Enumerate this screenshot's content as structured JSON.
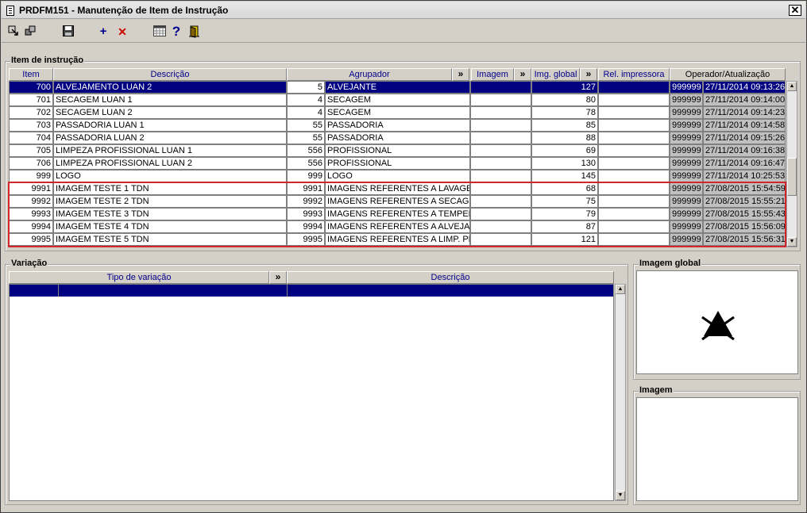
{
  "window": {
    "title": "PRDFM151 - Manutenção de Item de Instrução",
    "close_label": "✕"
  },
  "toolbar": {
    "icons": [
      "back-icon",
      "copy-icon",
      "save-icon",
      "add-icon",
      "delete-icon",
      "calendar-grid-icon",
      "help-icon",
      "exit-door-icon"
    ],
    "add_label": "+",
    "delete_label": "✕",
    "help_label": "?"
  },
  "item_section": {
    "legend": "Item de instrução",
    "columns": {
      "item": "Item",
      "descricao": "Descrição",
      "agrupador": "Agrupador",
      "imagem": "Imagem",
      "img_global": "Img. global",
      "rel_impressora": "Rel. impressora",
      "operador": "Operador/Atualização",
      "more": "»"
    },
    "rows": [
      {
        "item": "700",
        "descricao": "ALVEJAMENTO LUAN 2",
        "agr_code": "5",
        "agr_desc": "ALVEJANTE",
        "imagem": "",
        "img_global": "127",
        "rel": "",
        "operador": "999999",
        "data": "27/11/2014 09:13:26"
      },
      {
        "item": "701",
        "descricao": "SECAGEM LUAN 1",
        "agr_code": "4",
        "agr_desc": "SECAGEM",
        "imagem": "",
        "img_global": "80",
        "rel": "",
        "operador": "999999",
        "data": "27/11/2014 09:14:00"
      },
      {
        "item": "702",
        "descricao": "SECAGEM LUAN 2",
        "agr_code": "4",
        "agr_desc": "SECAGEM",
        "imagem": "",
        "img_global": "78",
        "rel": "",
        "operador": "999999",
        "data": "27/11/2014 09:14:23"
      },
      {
        "item": "703",
        "descricao": "PASSADORIA LUAN 1",
        "agr_code": "55",
        "agr_desc": "PASSADORIA",
        "imagem": "",
        "img_global": "85",
        "rel": "",
        "operador": "999999",
        "data": "27/11/2014 09:14:58"
      },
      {
        "item": "704",
        "descricao": "PASSADORIA LUAN 2",
        "agr_code": "55",
        "agr_desc": "PASSADORIA",
        "imagem": "",
        "img_global": "88",
        "rel": "",
        "operador": "999999",
        "data": "27/11/2014 09:15:26"
      },
      {
        "item": "705",
        "descricao": "LIMPEZA PROFISSIONAL LUAN 1",
        "agr_code": "556",
        "agr_desc": "PROFISSIONAL",
        "imagem": "",
        "img_global": "69",
        "rel": "",
        "operador": "999999",
        "data": "27/11/2014 09:16:38"
      },
      {
        "item": "706",
        "descricao": "LIMPEZA PROFISSIONAL LUAN 2",
        "agr_code": "556",
        "agr_desc": "PROFISSIONAL",
        "imagem": "",
        "img_global": "130",
        "rel": "",
        "operador": "999999",
        "data": "27/11/2014 09:16:47"
      },
      {
        "item": "999",
        "descricao": "LOGO",
        "agr_code": "999",
        "agr_desc": "LOGO",
        "imagem": "",
        "img_global": "145",
        "rel": "",
        "operador": "999999",
        "data": "27/11/2014 10:25:53"
      },
      {
        "item": "9991",
        "descricao": "IMAGEM TESTE 1 TDN",
        "agr_code": "9991",
        "agr_desc": "IMAGENS REFERENTES A LAVAGEM",
        "imagem": "",
        "img_global": "68",
        "rel": "",
        "operador": "999999",
        "data": "27/08/2015 15:54:59"
      },
      {
        "item": "9992",
        "descricao": "IMAGEM TESTE 2 TDN",
        "agr_code": "9992",
        "agr_desc": "IMAGENS REFERENTES A SECAGEM",
        "imagem": "",
        "img_global": "75",
        "rel": "",
        "operador": "999999",
        "data": "27/08/2015 15:55:21"
      },
      {
        "item": "9993",
        "descricao": "IMAGEM TESTE 3 TDN",
        "agr_code": "9993",
        "agr_desc": "IMAGENS REFERENTES A TEMPERAT",
        "imagem": "",
        "img_global": "79",
        "rel": "",
        "operador": "999999",
        "data": "27/08/2015 15:55:43"
      },
      {
        "item": "9994",
        "descricao": "IMAGEM TESTE 4 TDN",
        "agr_code": "9994",
        "agr_desc": "IMAGENS REFERENTES A ALVEJANT",
        "imagem": "",
        "img_global": "87",
        "rel": "",
        "operador": "999999",
        "data": "27/08/2015 15:56:09"
      },
      {
        "item": "9995",
        "descricao": "IMAGEM TESTE 5 TDN",
        "agr_code": "9995",
        "agr_desc": "IMAGENS REFERENTES A LIMP. PROF",
        "imagem": "",
        "img_global": "121",
        "rel": "",
        "operador": "999999",
        "data": "27/08/2015 15:56:31"
      }
    ]
  },
  "variacao_section": {
    "legend": "Variação",
    "columns": {
      "tipo": "Tipo de variação",
      "descricao": "Descrição",
      "more": "»"
    }
  },
  "imagem_global_section": {
    "legend": "Imagem global",
    "icon": "no-bleach-symbol-icon"
  },
  "imagem_section": {
    "legend": "Imagem"
  },
  "colors": {
    "selection": "#000080",
    "header_text": "#00008b",
    "highlight": "#d2262b",
    "background": "#d4d0c8"
  }
}
